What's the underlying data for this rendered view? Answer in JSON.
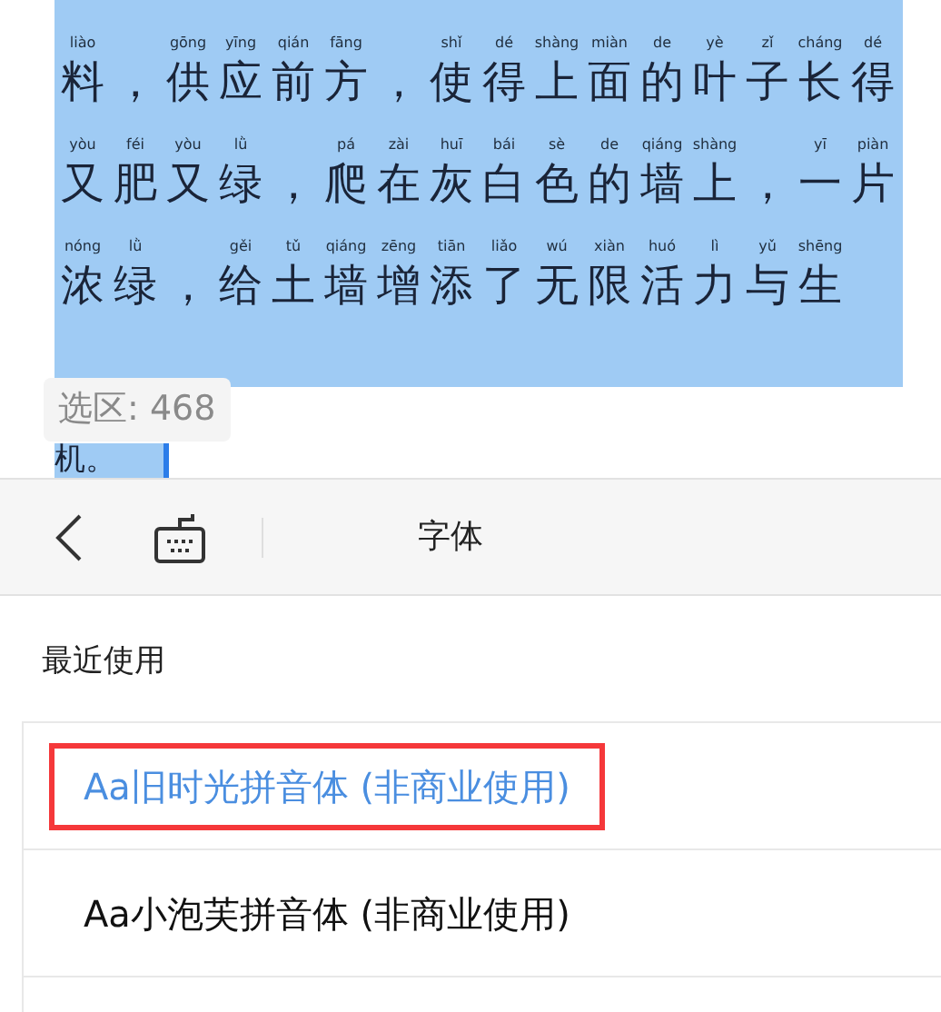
{
  "document": {
    "rows": [
      [
        {
          "char": "料",
          "pinyin": "liào"
        },
        {
          "char": "，"
        },
        {
          "char": "供",
          "pinyin": "gōng"
        },
        {
          "char": "应",
          "pinyin": "yīng"
        },
        {
          "char": "前",
          "pinyin": "qián"
        },
        {
          "char": "方",
          "pinyin": "fāng"
        },
        {
          "char": "，"
        },
        {
          "char": "使",
          "pinyin": "shǐ"
        },
        {
          "char": "得",
          "pinyin": "dé"
        },
        {
          "char": "上",
          "pinyin": "shàng"
        },
        {
          "char": "面",
          "pinyin": "miàn"
        },
        {
          "char": "的",
          "pinyin": "de"
        },
        {
          "char": "叶",
          "pinyin": "yè"
        },
        {
          "char": "子",
          "pinyin": "zǐ"
        },
        {
          "char": "长",
          "pinyin": "cháng"
        },
        {
          "char": "得",
          "pinyin": "dé"
        }
      ],
      [
        {
          "char": "又",
          "pinyin": "yòu"
        },
        {
          "char": "肥",
          "pinyin": "féi"
        },
        {
          "char": "又",
          "pinyin": "yòu"
        },
        {
          "char": "绿",
          "pinyin": "lǜ"
        },
        {
          "char": "，"
        },
        {
          "char": "爬",
          "pinyin": "pá"
        },
        {
          "char": "在",
          "pinyin": "zài"
        },
        {
          "char": "灰",
          "pinyin": "huī"
        },
        {
          "char": "白",
          "pinyin": "bái"
        },
        {
          "char": "色",
          "pinyin": "sè"
        },
        {
          "char": "的",
          "pinyin": "de"
        },
        {
          "char": "墙",
          "pinyin": "qiáng"
        },
        {
          "char": "上",
          "pinyin": "shàng"
        },
        {
          "char": "，"
        },
        {
          "char": "一",
          "pinyin": "yī"
        },
        {
          "char": "片",
          "pinyin": "piàn"
        }
      ],
      [
        {
          "char": "浓",
          "pinyin": "nóng"
        },
        {
          "char": "绿",
          "pinyin": "lǜ"
        },
        {
          "char": "，"
        },
        {
          "char": "给",
          "pinyin": "gěi"
        },
        {
          "char": "土",
          "pinyin": "tǔ"
        },
        {
          "char": "墙",
          "pinyin": "qiáng"
        },
        {
          "char": "增",
          "pinyin": "zēng"
        },
        {
          "char": "添",
          "pinyin": "tiān"
        },
        {
          "char": "了",
          "pinyin": "liǎo"
        },
        {
          "char": "无",
          "pinyin": "wú"
        },
        {
          "char": "限",
          "pinyin": "xiàn"
        },
        {
          "char": "活",
          "pinyin": "huó"
        },
        {
          "char": "力",
          "pinyin": "lì"
        },
        {
          "char": "与",
          "pinyin": "yǔ"
        },
        {
          "char": "生",
          "pinyin": "shēng"
        }
      ]
    ],
    "last_line": "机。",
    "selection_badge": "选区: 468"
  },
  "toolbar": {
    "title": "字体"
  },
  "section_title": "最近使用",
  "fonts": [
    {
      "label": "Aa旧时光拼音体 (非商业使用)",
      "selected": true,
      "outlined": true
    },
    {
      "label": "Aa小泡芙拼音体 (非商业使用)",
      "selected": false,
      "outlined": false
    }
  ]
}
